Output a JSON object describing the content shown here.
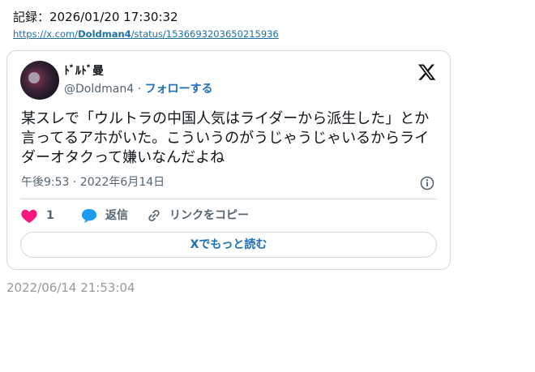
{
  "record": {
    "label": "記録：2026/01/20 17:30:32",
    "url_prefix": "https://x.com/",
    "url_user": "Doldman4",
    "url_suffix": "/status/1536693203650215936"
  },
  "tweet": {
    "display_name": "ﾄﾞﾙﾄﾞ曼",
    "handle": "@Doldman4",
    "separator": "·",
    "follow_label": "フォローする",
    "text": "某スレで「ウルトラの中国人気はライダーから派生した」とか言ってるアホがいた。こういうのがうじゃうじゃいるからライダーオタクって嫌いなんだよね",
    "timestamp": "午後9:53 · 2022年6月14日",
    "like_count": "1",
    "reply_label": "返信",
    "copy_link_label": "リンクをコピー",
    "read_more_label": "Xでもっと読む"
  },
  "footer": {
    "date": "2022/06/14 21:53:04"
  },
  "colors": {
    "like": "#f91880",
    "reply": "#1d9bf0",
    "link": "#1d6fb8",
    "muted": "#536471",
    "border": "#cfd9de"
  },
  "icons": [
    "x-logo-icon",
    "info-icon",
    "heart-icon",
    "reply-bubble-icon",
    "link-icon"
  ]
}
